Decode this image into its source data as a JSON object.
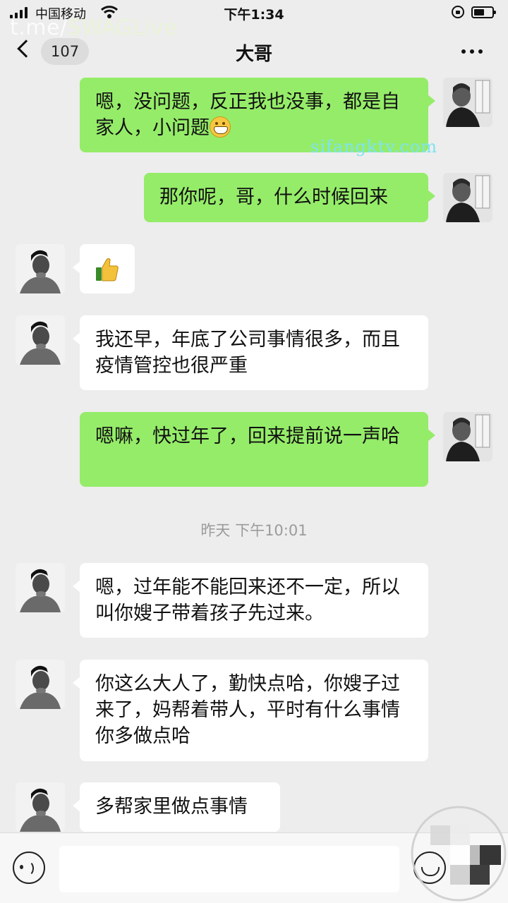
{
  "status_bar": {
    "carrier": "中国移动",
    "time": "下午1:34",
    "watermark_prefix": "t.me/",
    "watermark_brand": "SWAGLive"
  },
  "nav": {
    "unread_count": "107",
    "title": "大哥"
  },
  "watermark_site": "sifangktv.com",
  "messages": [
    {
      "side": "right",
      "text": "嗯，没问题，反正我也没事，都是自家人，小问题",
      "emoji": "grinning-face-emoji"
    },
    {
      "side": "right",
      "text": "那你呢，哥，什么时候回来"
    },
    {
      "side": "left",
      "emoji": "thumbs-up-emoji"
    },
    {
      "side": "left",
      "text": "我还早，年底了公司事情很多，而且疫情管控也很严重"
    },
    {
      "side": "right",
      "text": "嗯嘛，快过年了，回来提前说一声哈"
    },
    {
      "side": "left",
      "text": "嗯，过年能不能回来还不一定，所以叫你嫂子带着孩子先过来。"
    },
    {
      "side": "left",
      "text": "你这么大人了，勤快点哈，你嫂子过来了，妈帮着带人，平时有什么事情你多做点哈"
    },
    {
      "side": "left",
      "text": "多帮家里做点事情"
    }
  ],
  "timestamp": "昨天 下午10:01",
  "input": {
    "value": "",
    "placeholder": ""
  },
  "colors": {
    "background": "#ededed",
    "outgoing_bubble": "#95ec69",
    "incoming_bubble": "#ffffff",
    "timestamp_text": "#9b9b9b"
  }
}
